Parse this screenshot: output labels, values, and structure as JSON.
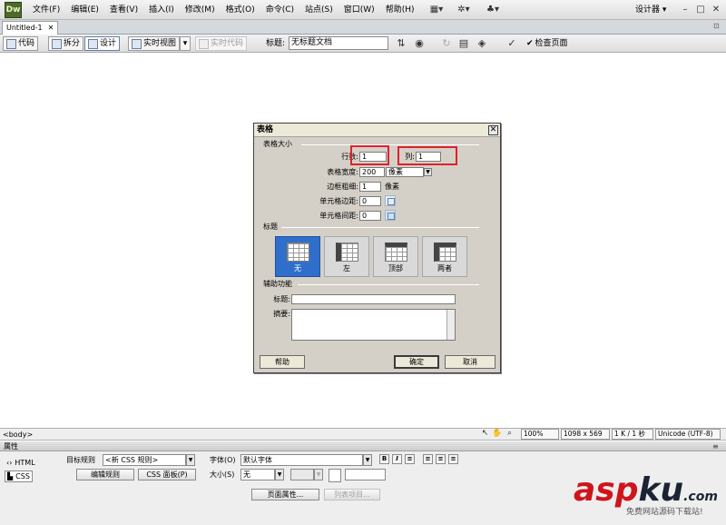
{
  "app": {
    "logo": "Dw",
    "menus": [
      "文件(F)",
      "编辑(E)",
      "查看(V)",
      "插入(I)",
      "修改(M)",
      "格式(O)",
      "命令(C)",
      "站点(S)",
      "窗口(W)",
      "帮助(H)"
    ],
    "workspace": "设计器 ▾"
  },
  "tab": {
    "name": "Untitled-1",
    "close": "✕",
    "restore": "⊡"
  },
  "doc_toolbar": {
    "code": "代码",
    "split": "拆分",
    "design": "设计",
    "live_view": "实时视图",
    "live_code": "实时代码",
    "title_label": "标题:",
    "title_value": "无标题文档",
    "check_page": "检查页面"
  },
  "dialog": {
    "title": "表格",
    "close": "✕",
    "size_section": "表格大小",
    "rows_label": "行数:",
    "rows_value": "1",
    "cols_label": "列:",
    "cols_value": "1",
    "width_label": "表格宽度:",
    "width_value": "200",
    "width_unit": "像素",
    "border_label": "边框粗细:",
    "border_value": "1",
    "border_unit": "像素",
    "padding_label": "单元格边距:",
    "padding_value": "0",
    "spacing_label": "单元格间距:",
    "spacing_value": "0",
    "header_section": "标题",
    "header_options": [
      "无",
      "左",
      "顶部",
      "两者"
    ],
    "header_selected": 0,
    "access_section": "辅助功能",
    "caption_label": "标题:",
    "summary_label": "摘要:",
    "help": "帮助",
    "ok": "确定",
    "cancel": "取消"
  },
  "status": {
    "tag": "<body>",
    "zoom": "100%",
    "dimensions": "1098 x 569",
    "size": "1 K / 1 秒",
    "encoding": "Unicode (UTF-8)"
  },
  "properties": {
    "header": "属性",
    "tab_html": "HTML",
    "tab_css": "CSS",
    "target_rule_label": "目标规则",
    "target_rule_value": "<新 CSS 规则>",
    "edit_rule": "编辑规则",
    "css_panel": "CSS 面板(P)",
    "font_label": "字体(O)",
    "font_value": "默认字体",
    "size_label": "大小(S)",
    "size_value": "无",
    "page_props": "页面属性...",
    "list_item": "列表项目..."
  },
  "watermark": {
    "main_a": "asp",
    "main_b": "ku",
    "suffix": ".com",
    "sub": "免费网站源码下载站!"
  },
  "colors": {
    "selected": "#2f6fcb",
    "highlight": "#e0202a",
    "watermark_red": "#d0141b"
  }
}
